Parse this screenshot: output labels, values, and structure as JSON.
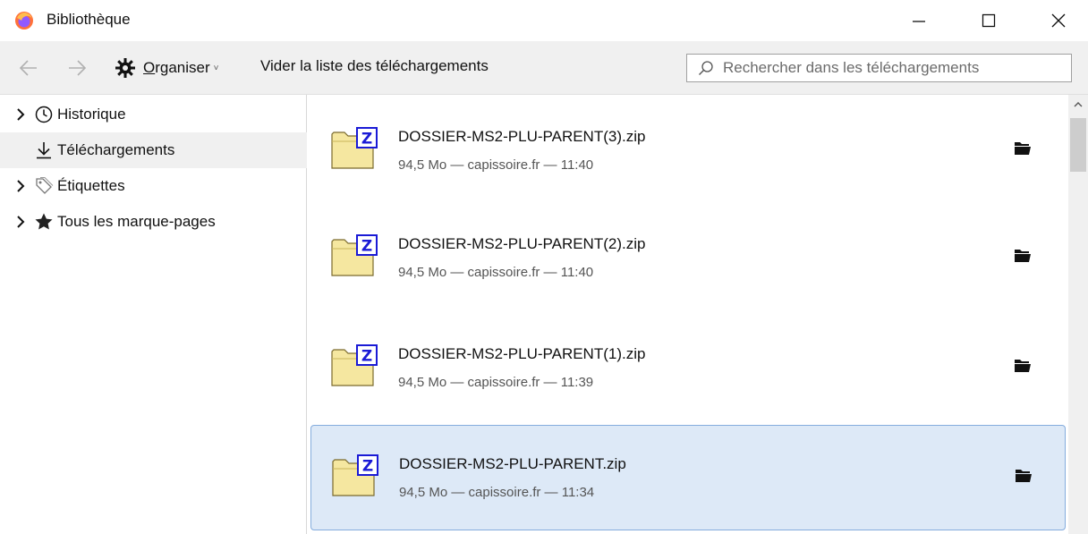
{
  "window": {
    "title": "Bibliothèque",
    "minimize": "—",
    "maximize": "☐",
    "close": "✕"
  },
  "toolbar": {
    "organise_label": "Organiser",
    "organise_caret": "˅",
    "clear_label": "Vider la liste des téléchargements",
    "search_placeholder": "Rechercher dans les téléchargements"
  },
  "sidebar": {
    "items": [
      {
        "label": "Historique",
        "icon": "clock-icon",
        "expandable": true,
        "selected": false
      },
      {
        "label": "Téléchargements",
        "icon": "download-icon",
        "expandable": false,
        "selected": true
      },
      {
        "label": "Étiquettes",
        "icon": "tag-icon",
        "expandable": true,
        "selected": false
      },
      {
        "label": "Tous les marque-pages",
        "icon": "star-icon",
        "expandable": true,
        "selected": false
      }
    ]
  },
  "downloads": [
    {
      "name": "DOSSIER-MS2-PLU-PARENT(3).zip",
      "meta": "94,5 Mo — capissoire.fr — 11:40",
      "selected": false
    },
    {
      "name": "DOSSIER-MS2-PLU-PARENT(2).zip",
      "meta": "94,5 Mo — capissoire.fr — 11:40",
      "selected": false
    },
    {
      "name": "DOSSIER-MS2-PLU-PARENT(1).zip",
      "meta": "94,5 Mo — capissoire.fr — 11:39",
      "selected": false
    },
    {
      "name": "DOSSIER-MS2-PLU-PARENT.zip",
      "meta": "94,5 Mo — capissoire.fr — 11:34",
      "selected": true
    }
  ],
  "colors": {
    "selection_bg": "#dde9f7",
    "selection_border": "#84acdd",
    "toolbar_bg": "#f0f0f0",
    "zip_badge": "#1a1ad6"
  }
}
